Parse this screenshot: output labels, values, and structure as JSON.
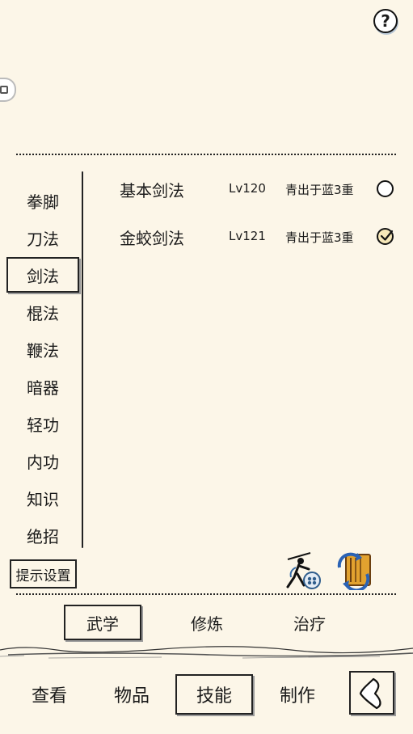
{
  "header": {
    "help_label": "?"
  },
  "categories": [
    {
      "label": "拳脚"
    },
    {
      "label": "刀法"
    },
    {
      "label": "剑法",
      "selected": true
    },
    {
      "label": "棍法"
    },
    {
      "label": "鞭法"
    },
    {
      "label": "暗器"
    },
    {
      "label": "轻功"
    },
    {
      "label": "内功"
    },
    {
      "label": "知识"
    },
    {
      "label": "绝招"
    }
  ],
  "hint_button": "提示设置",
  "skills": [
    {
      "name": "基本剑法",
      "level": "Lv120",
      "realm": "青出于蓝3重",
      "checked": false
    },
    {
      "name": "金蛟剑法",
      "level": "Lv121",
      "realm": "青出于蓝3重",
      "checked": true
    }
  ],
  "action_icons": [
    "swordsman-practice-icon",
    "book-swap-icon"
  ],
  "subtabs": [
    {
      "label": "武学",
      "selected": true
    },
    {
      "label": "修炼"
    },
    {
      "label": "治疗"
    }
  ],
  "bottom_nav": [
    {
      "label": "查看"
    },
    {
      "label": "物品"
    },
    {
      "label": "技能",
      "selected": true
    },
    {
      "label": "制作"
    }
  ],
  "colors": {
    "background": "#fcf6e8",
    "ink": "#1a1a1a",
    "checked_fill": "#f6e7b8"
  }
}
